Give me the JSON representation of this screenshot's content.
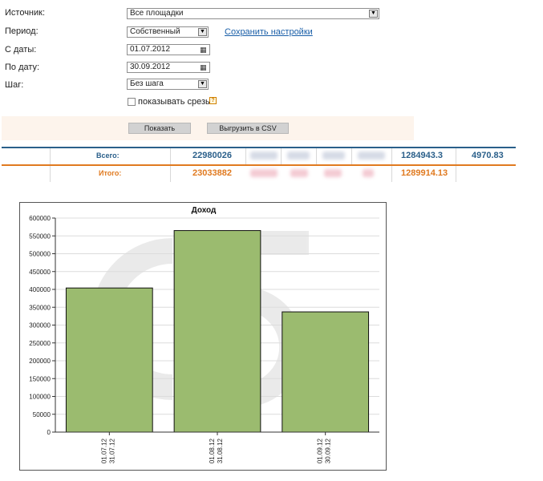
{
  "form": {
    "source_label": "Источник:",
    "source_value": "Все площадки",
    "period_label": "Период:",
    "period_value": "Собственный",
    "save_settings_link": "Сохранить настройки",
    "date_from_label": "С даты:",
    "date_from_value": "01.07.2012",
    "date_to_label": "По дату:",
    "date_to_value": "30.09.2012",
    "step_label": "Шаг:",
    "step_value": "Без шага",
    "show_slices_label": "показывать срезы",
    "show_button": "Показать",
    "export_csv_button": "Выгрузить в CSV"
  },
  "totals": {
    "all_label": "Всего:",
    "all_value1": "22980026",
    "all_value2": "1284943.3",
    "all_value3": "4970.83",
    "sum_label": "Итого:",
    "sum_value1": "23033882",
    "sum_value2": "1289914.13"
  },
  "colors": {
    "accent_blue": "#2a5f8a",
    "accent_orange": "#e07a20",
    "bar_fill": "#9bbb6f"
  },
  "chart_data": {
    "type": "bar",
    "title": "Доход",
    "categories": [
      [
        "01.07.12",
        "31.07.12"
      ],
      [
        "01.08.12",
        "31.08.12"
      ],
      [
        "01.09.12",
        "30.09.12"
      ]
    ],
    "values": [
      404000,
      565000,
      337000
    ],
    "ylim": [
      0,
      600000
    ],
    "yticks": [
      "0",
      "50000",
      "100000",
      "150000",
      "200000",
      "250000",
      "300000",
      "350000",
      "400000",
      "450000",
      "500000",
      "550000",
      "600000"
    ],
    "grid": true
  }
}
